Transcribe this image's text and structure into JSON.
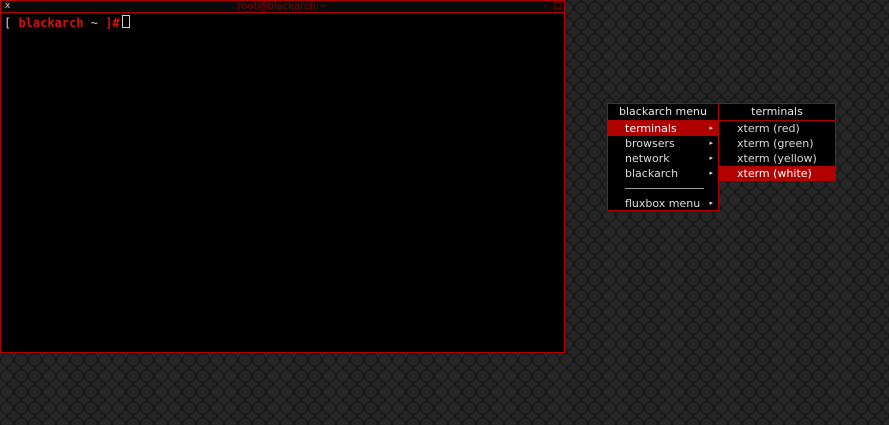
{
  "terminal": {
    "title": "root@blackarch:~",
    "close_glyph": "x",
    "minimize_glyph": "-",
    "maximize_glyph": "□",
    "prompt_open": "[ ",
    "prompt_host": "blackarch",
    "prompt_path": " ~ ",
    "prompt_close": "]",
    "prompt_symbol": "#"
  },
  "main_menu": {
    "title": "blackarch menu",
    "items": [
      {
        "label": "terminals",
        "submenu": true,
        "selected": true
      },
      {
        "label": "browsers",
        "submenu": true
      },
      {
        "label": "network",
        "submenu": true
      },
      {
        "label": "blackarch",
        "submenu": true
      },
      {
        "separator": true
      },
      {
        "label": "fluxbox menu",
        "submenu": true
      }
    ]
  },
  "sub_menu": {
    "title": "terminals",
    "items": [
      {
        "label": "xterm (red)"
      },
      {
        "label": "xterm (green)"
      },
      {
        "label": "xterm (yellow)"
      },
      {
        "label": "xterm (white)",
        "selected": true
      }
    ]
  },
  "colors": {
    "accent": "#b00000",
    "background": "#1c1c1c",
    "terminal_bg": "#000000"
  }
}
